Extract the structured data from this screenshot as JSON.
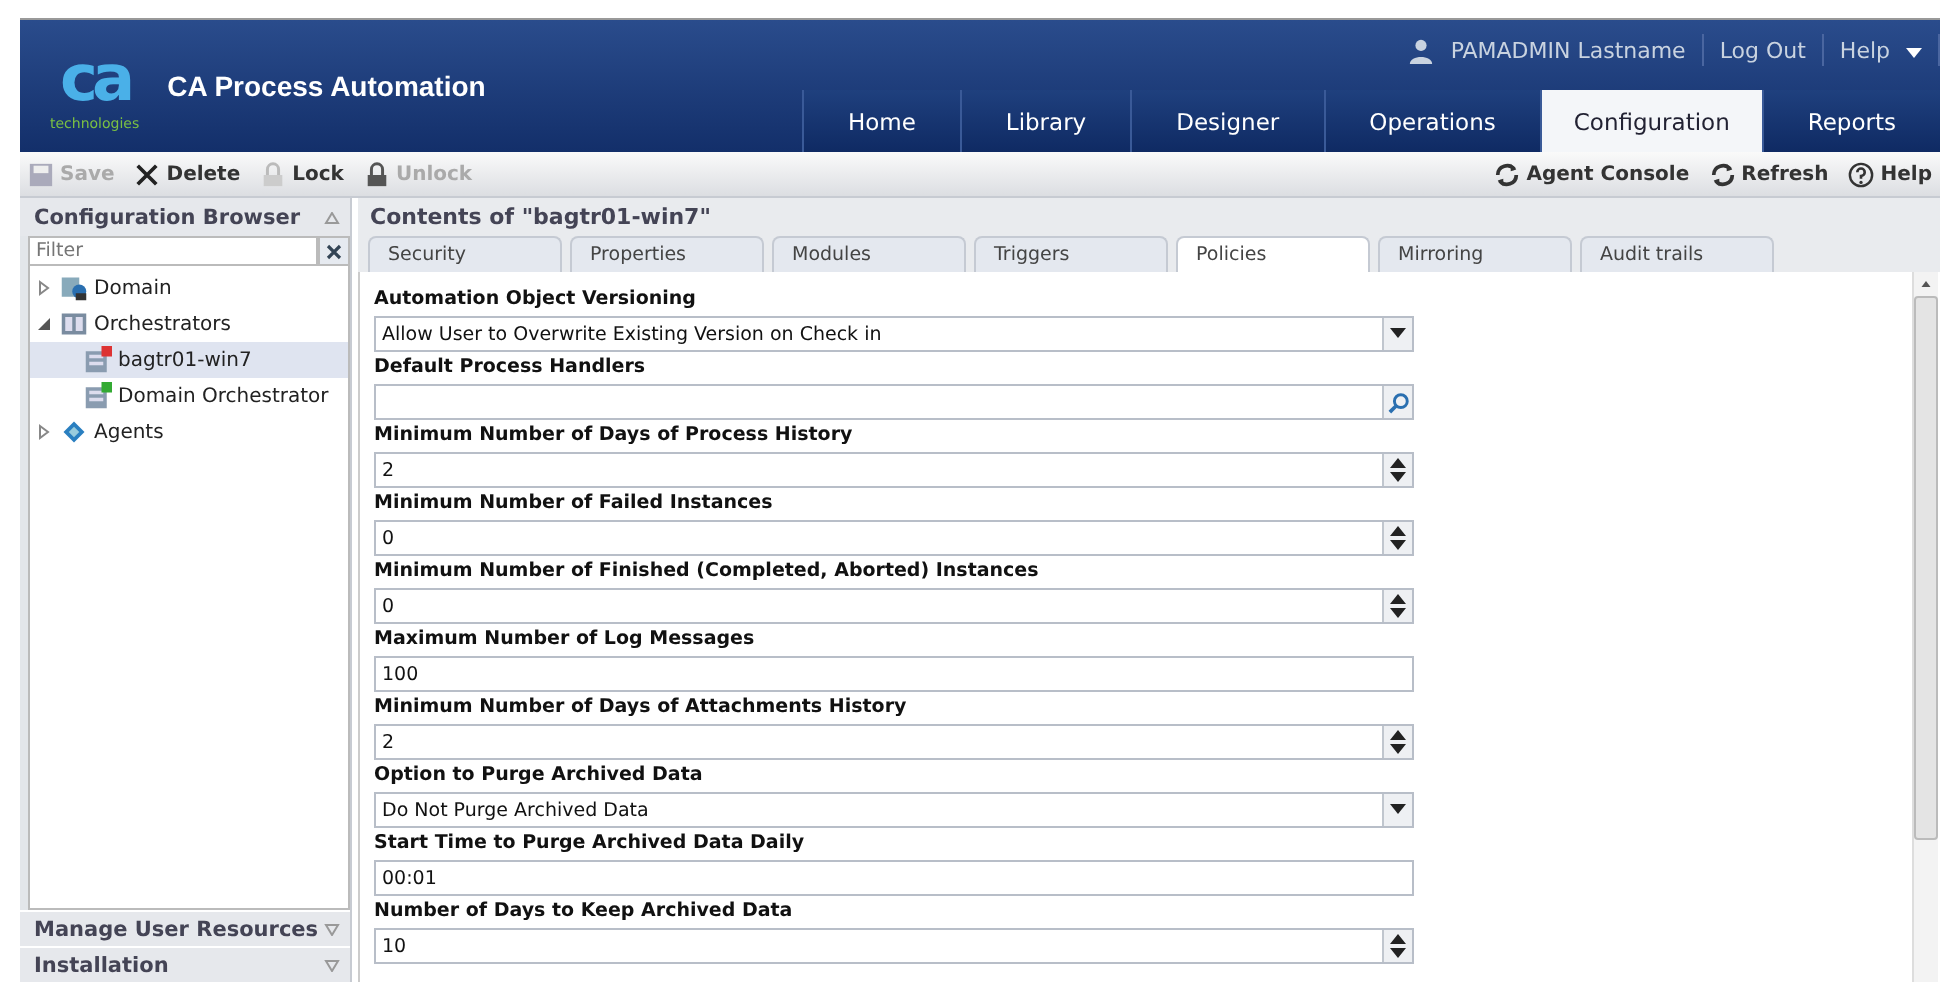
{
  "app": {
    "logo_text": "ca",
    "logo_sub": "technologies",
    "title": "CA Process Automation"
  },
  "user_bar": {
    "user": "PAMADMIN Lastname",
    "logout": "Log Out",
    "help": "Help"
  },
  "nav_tabs": [
    {
      "label": "Home",
      "selected": false
    },
    {
      "label": "Library",
      "selected": false
    },
    {
      "label": "Designer",
      "selected": false
    },
    {
      "label": "Operations",
      "selected": false
    },
    {
      "label": "Configuration",
      "selected": true
    },
    {
      "label": "Reports",
      "selected": false
    }
  ],
  "toolbar": {
    "left": [
      {
        "label": "Save",
        "kind": "save",
        "disabled": true
      },
      {
        "label": "Delete",
        "kind": "delete",
        "disabled": false
      },
      {
        "label": "Lock",
        "kind": "lock",
        "disabled": false
      },
      {
        "label": "Unlock",
        "kind": "unlock",
        "disabled": true
      }
    ],
    "right": [
      {
        "label": "Agent Console",
        "kind": "refresh"
      },
      {
        "label": "Refresh",
        "kind": "refresh"
      },
      {
        "label": "Help",
        "kind": "help"
      }
    ]
  },
  "sidebar": {
    "title": "Configuration Browser",
    "filter_placeholder": "Filter",
    "tree": [
      {
        "label": "Domain",
        "kind": "domain",
        "expanded": false,
        "selected": false
      },
      {
        "label": "Orchestrators",
        "kind": "group",
        "expanded": true,
        "selected": false,
        "children": [
          {
            "label": "bagtr01-win7",
            "kind": "orchestrator-alert",
            "selected": true
          },
          {
            "label": "Domain Orchestrator",
            "kind": "orchestrator",
            "selected": false
          }
        ]
      },
      {
        "label": "Agents",
        "kind": "agents",
        "expanded": false,
        "selected": false
      }
    ],
    "sections": [
      "Manage User Resources",
      "Installation"
    ]
  },
  "content": {
    "title": "Contents of \"bagtr01-win7\"",
    "tabs": [
      {
        "label": "Security",
        "selected": false
      },
      {
        "label": "Properties",
        "selected": false
      },
      {
        "label": "Modules",
        "selected": false
      },
      {
        "label": "Triggers",
        "selected": false
      },
      {
        "label": "Policies",
        "selected": true
      },
      {
        "label": "Mirroring",
        "selected": false
      },
      {
        "label": "Audit trails",
        "selected": false
      }
    ],
    "fields": [
      {
        "label": "Automation Object Versioning",
        "kind": "select",
        "value": "Allow User to Overwrite Existing Version on Check in"
      },
      {
        "label": "Default Process Handlers",
        "kind": "search"
      },
      {
        "label": "Minimum Number of Days of Process History",
        "kind": "spinner",
        "value": "2"
      },
      {
        "label": "Minimum Number of Failed Instances",
        "kind": "spinner",
        "value": "0"
      },
      {
        "label": "Minimum Number of Finished (Completed, Aborted) Instances",
        "kind": "spinner",
        "value": "0"
      },
      {
        "label": "Maximum Number of Log Messages",
        "kind": "text",
        "value": "100"
      },
      {
        "label": "Minimum Number of Days of Attachments History",
        "kind": "spinner",
        "value": "2"
      },
      {
        "label": "Option to Purge Archived Data",
        "kind": "select",
        "value": "Do Not Purge Archived Data"
      },
      {
        "label": "Start Time to Purge Archived Data Daily",
        "kind": "text",
        "value": "00:01"
      },
      {
        "label": "Number of Days to Keep Archived Data",
        "kind": "spinner",
        "value": "10"
      }
    ]
  }
}
